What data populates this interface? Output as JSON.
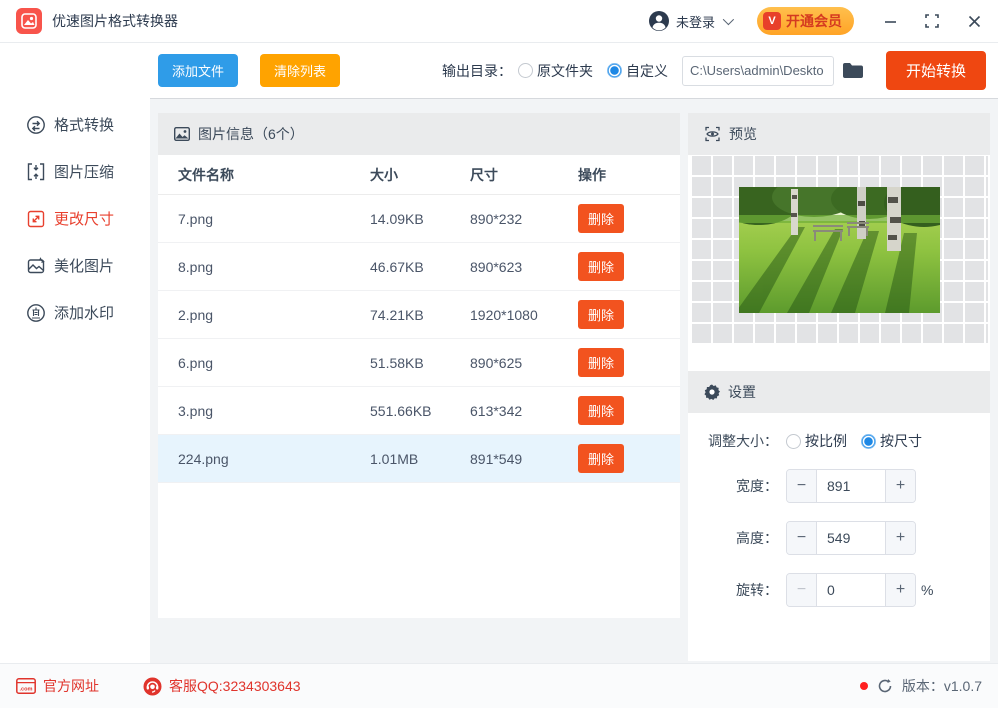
{
  "app": {
    "title": "优速图片格式转换器"
  },
  "titlebar": {
    "login_label": "未登录",
    "vip_label": "开通会员"
  },
  "toolbar": {
    "add_files": "添加文件",
    "clear_list": "清除列表",
    "output_dir_label": "输出目录：",
    "radio_source_label": "原文件夹",
    "radio_custom_label": "自定义",
    "path_value": "C:\\Users\\admin\\Deskto",
    "start_convert": "开始转换"
  },
  "sidebar": {
    "items": [
      {
        "label": "格式转换",
        "icon": "convert-icon"
      },
      {
        "label": "图片压缩",
        "icon": "compress-icon"
      },
      {
        "label": "更改尺寸",
        "icon": "resize-icon",
        "active": true
      },
      {
        "label": "美化图片",
        "icon": "beautify-icon"
      },
      {
        "label": "添加水印",
        "icon": "watermark-icon"
      }
    ]
  },
  "table": {
    "panel_title": "图片信息（6个）",
    "headers": {
      "name": "文件名称",
      "size": "大小",
      "dims": "尺寸",
      "ops": "操作"
    },
    "delete_label": "删除",
    "rows": [
      {
        "name": "7.png",
        "size": "14.09KB",
        "dims": "890*232"
      },
      {
        "name": "8.png",
        "size": "46.67KB",
        "dims": "890*623"
      },
      {
        "name": "2.png",
        "size": "74.21KB",
        "dims": "1920*1080"
      },
      {
        "name": "6.png",
        "size": "51.58KB",
        "dims": "890*625"
      },
      {
        "name": "3.png",
        "size": "551.66KB",
        "dims": "613*342"
      },
      {
        "name": "224.png",
        "size": "1.01MB",
        "dims": "891*549",
        "selected": true
      }
    ]
  },
  "preview": {
    "panel_title": "预览",
    "image_alt": "park-scene-preview"
  },
  "settings": {
    "panel_title": "设置",
    "resize_label": "调整大小：",
    "radio_ratio_label": "按比例",
    "radio_size_label": "按尺寸",
    "width_label": "宽度：",
    "width_value": "891",
    "height_label": "高度：",
    "height_value": "549",
    "rotate_label": "旋转：",
    "rotate_value": "0",
    "rotate_suffix": "%",
    "minus_label": "−",
    "plus_label": "+"
  },
  "footer": {
    "website_label": "官方网址",
    "qq_label": "客服QQ:3234303643",
    "version_label": "版本：v1.0.7"
  },
  "colors": {
    "accent_blue": "#2f9ce8",
    "accent_orange": "#ffa300",
    "accent_red_orange": "#ef4711",
    "active_red": "#e8402e",
    "selected_row": "#e7f4fd",
    "footer_red": "#e0342c"
  }
}
